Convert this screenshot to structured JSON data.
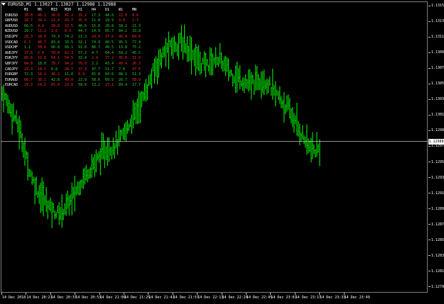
{
  "window": {
    "title": "EURUSD,M1  1.13027 1.13027 1.12988 1.12988"
  },
  "price": {
    "current": "1.12988",
    "y_ticks": [
      "1.13155",
      "1.13135",
      "1.13115",
      "1.13095",
      "1.13075",
      "1.13055",
      "1.13034",
      "1.13015",
      "1.12995",
      "1.12975",
      "1.12955",
      "1.12935",
      "1.12915",
      "1.12895",
      "1.12875",
      "1.12855",
      "1.12835",
      "1.12815",
      "1.12795"
    ]
  },
  "time_axis": {
    "labels": [
      "14 Dec 2018",
      "14 Dec 20:21",
      "14 Dec 20:37",
      "14 Dec 20:53",
      "14 Dec 21:09",
      "14 Dec 21:25",
      "14 Dec 21:41",
      "14 Dec 21:57",
      "14 Dec 22:13",
      "14 Dec 22:29",
      "14 Dec 22:45",
      "14 Dec 23:01",
      "14 Dec 23:17",
      "14 Dec 23:33",
      "14 Dec 23:49"
    ]
  },
  "colors": {
    "candle": "#00ff00",
    "positive": "#2fd02f",
    "negative": "#ff2b2b",
    "price_line": "#c0c0c0"
  },
  "strength_matrix": {
    "headers": [
      "M1",
      "M5",
      "M15",
      "M30",
      "H1",
      "H4",
      "D1",
      "W1",
      "MN"
    ],
    "rows": [
      {
        "symbol": "EURUSD",
        "values": [
          "36.0",
          "46.1",
          "38.6",
          "41.2",
          "35.2",
          "17.3",
          "44.6",
          "22.6",
          "9.6"
        ],
        "signs": [
          "neg",
          "neg",
          "neg",
          "neg",
          "neg",
          "pos",
          "pos",
          "neg",
          "neg"
        ]
      },
      {
        "symbol": "GBPUSD",
        "values": [
          "18.7",
          "34.2",
          "22.4",
          "43.7",
          "35.9",
          "11.0",
          "29.9",
          "9.8",
          "2.7"
        ],
        "signs": [
          "neg",
          "neg",
          "neg",
          "neg",
          "neg",
          "pos",
          "pos",
          "neg",
          "neg"
        ]
      },
      {
        "symbol": "AUDUSD",
        "values": [
          "66.5",
          "4.9",
          "38.8",
          "32.5",
          "46.6",
          "15.8",
          "28.8",
          "58.2",
          "21.3"
        ],
        "signs": [
          "pos",
          "neg",
          "neg",
          "neg",
          "pos",
          "pos",
          "pos",
          "pos",
          "pos"
        ]
      },
      {
        "symbol": "NZDUSD",
        "values": [
          "29.7",
          "11.2",
          "2.6",
          "8.3",
          "44.7",
          "14.9",
          "65.7",
          "84.2",
          "33.8"
        ],
        "signs": [
          "pos",
          "neg",
          "neg",
          "neg",
          "pos",
          "pos",
          "pos",
          "pos",
          "pos"
        ]
      },
      {
        "symbol": "USDJPY",
        "values": [
          "20.3",
          "20.0",
          "79.3",
          "74.2",
          "21.3",
          "24.8",
          "37.6",
          "46.4",
          "60.6"
        ],
        "signs": [
          "neg",
          "neg",
          "pos",
          "pos",
          "pos",
          "neg",
          "neg",
          "neg",
          "neg"
        ]
      },
      {
        "symbol": "USDCAD",
        "values": [
          "6.3",
          "46.7",
          "83.4",
          "33.5",
          "32.1",
          "74.9",
          "80.5",
          "95.5",
          "77.4"
        ],
        "signs": [
          "neg",
          "neg",
          "pos",
          "pos",
          "pos",
          "pos",
          "pos",
          "pos",
          "pos"
        ]
      },
      {
        "symbol": "USDCHF",
        "values": [
          "1.1",
          "58.6",
          "66.8",
          "68.1",
          "91.6",
          "86.7",
          "48.5",
          "13.8",
          "75.2"
        ],
        "signs": [
          "pos",
          "neg",
          "pos",
          "pos",
          "pos",
          "pos",
          "pos",
          "pos",
          "pos"
        ]
      },
      {
        "symbol": "AUDJPY",
        "values": [
          "37.6",
          "2.6",
          "78.8",
          "62.3",
          "57.2",
          "4.7",
          "64.4",
          "59.2",
          "45.5"
        ],
        "signs": [
          "neg",
          "neg",
          "neg",
          "neg",
          "pos",
          "pos",
          "pos",
          "pos",
          "pos"
        ]
      },
      {
        "symbol": "EURJPY",
        "values": [
          "60.6",
          "23.8",
          "54.1",
          "54.5",
          "33.4",
          "2.4",
          "77.2",
          "35.0",
          "31.6"
        ],
        "signs": [
          "neg",
          "neg",
          "neg",
          "neg",
          "pos",
          "neg",
          "neg",
          "neg",
          "neg"
        ]
      },
      {
        "symbol": "GBPJPY",
        "values": [
          "64.8",
          "18.0",
          "78.7",
          "94.2",
          "70.0",
          "2.2",
          "43.4",
          "49.4",
          "26.3"
        ],
        "signs": [
          "neg",
          "pos",
          "neg",
          "neg",
          "neg",
          "pos",
          "pos",
          "neg",
          "neg"
        ]
      },
      {
        "symbol": "CADJPY",
        "values": [
          "23.3",
          "18.1",
          "6.8",
          "26.7",
          "37.0",
          "47.7",
          "51.7",
          "7.6",
          "47.5"
        ],
        "signs": [
          "neg",
          "neg",
          "pos",
          "neg",
          "neg",
          "pos",
          "pos",
          "pos",
          "neg"
        ]
      },
      {
        "symbol": "EURGBP",
        "values": [
          "72.3",
          "16.2",
          "46.2",
          "11.0",
          "8.9",
          "65.8",
          "64.6",
          "88.1",
          "51.3"
        ],
        "signs": [
          "pos",
          "neg",
          "neg",
          "pos",
          "neg",
          "pos",
          "pos",
          "pos",
          "pos"
        ]
      },
      {
        "symbol": "EURAUD",
        "values": [
          "66.7",
          "38.1",
          "42.8",
          "49.0",
          "22.9",
          "58.6",
          "69.5",
          "26.7",
          "58.9"
        ],
        "signs": [
          "neg",
          "neg",
          "pos",
          "neg",
          "pos",
          "pos",
          "pos",
          "pos",
          "neg"
        ]
      },
      {
        "symbol": "EURCAD",
        "values": [
          "29.3",
          "24.2",
          "65.0",
          "23.0",
          "58.6",
          "13.2",
          "23.1",
          "89.4",
          "17.7"
        ],
        "signs": [
          "neg",
          "neg",
          "neg",
          "neg",
          "pos",
          "pos",
          "neg",
          "pos",
          "pos"
        ]
      }
    ]
  },
  "chart_data": {
    "type": "line",
    "series": [
      {
        "values": [
          1.1305,
          1.13035,
          1.1302,
          1.12995,
          1.1296,
          1.12935,
          1.1292,
          1.1291,
          1.129,
          1.12895,
          1.12905,
          1.12915,
          1.1293,
          1.12945,
          1.12955,
          1.12965,
          1.12975,
          1.1298,
          1.12985,
          1.12995,
          1.1301,
          1.13025,
          1.1304,
          1.1306,
          1.1308,
          1.13095,
          1.13105,
          1.1311,
          1.13115,
          1.1311,
          1.131,
          1.1309,
          1.13085,
          1.1309,
          1.13095,
          1.13085,
          1.13075,
          1.1307,
          1.13065,
          1.1306,
          1.13065,
          1.1307,
          1.1306,
          1.1305,
          1.1304,
          1.1303,
          1.13015,
          1.13,
          1.12985,
          1.12975,
          1.1298
        ]
      }
    ],
    "ylim": [
      1.12795,
      1.13165
    ],
    "grid": false
  }
}
